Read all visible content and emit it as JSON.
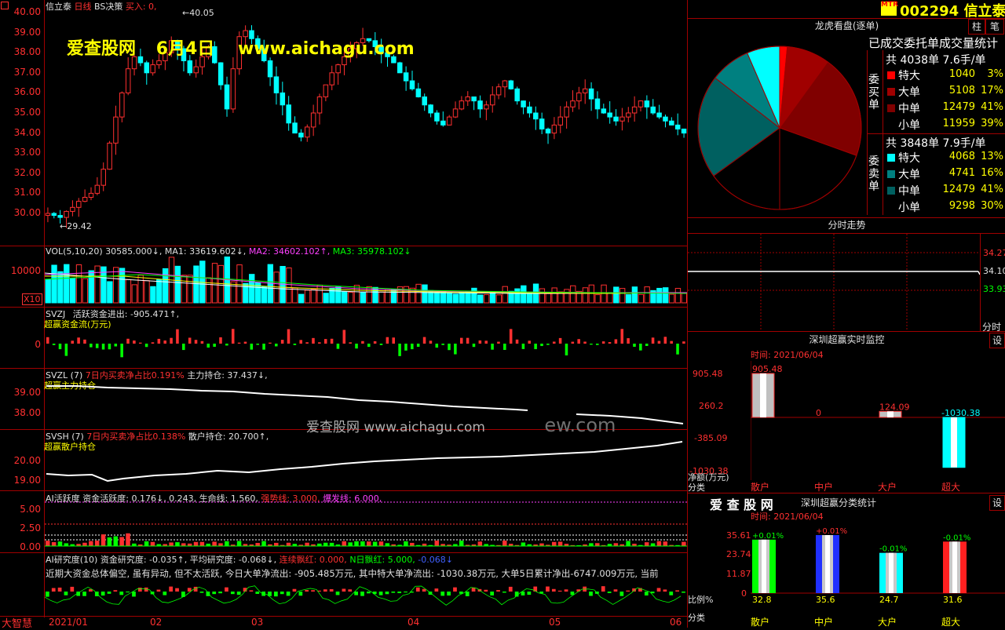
{
  "main": {
    "stock_name": "信立泰",
    "period": "日线",
    "indicator": "BS决策",
    "buy_label": "买入: 0,",
    "high_mark": "40.05",
    "low_mark": "29.42",
    "y_ticks": [
      "40.00",
      "39.00",
      "38.00",
      "37.00",
      "36.00",
      "35.00",
      "34.00",
      "33.00",
      "32.00",
      "31.00",
      "30.00"
    ],
    "watermark_site": "爱查股网",
    "watermark_date": "6月4日",
    "watermark_url": "www.aichagu.com",
    "center_watermark": "爱查股网   www.aichagu.com",
    "center_watermark_tail": "ew.com"
  },
  "vol": {
    "header": "VOL(5,10,20) 30585.000↓, MA1: 33619.602↓, MA2: 34602.102↑, MA3: 35978.102↓",
    "label": "VOL(5,10,20)",
    "value": "30585.000↓,",
    "ma1": "MA1: 33619.602↓,",
    "ma2": "MA2: 34602.102↑,",
    "ma3": "MA3: 35978.102↓",
    "tick": "10000",
    "unit": "X10"
  },
  "svzj": {
    "label": "SVZJ",
    "text": "活跃资金进出: -905.471↑,",
    "sub": "超赢资金流(万元)",
    "tick": "0"
  },
  "svzl": {
    "label": "SVZL (7)",
    "ratio": "7日内买卖净占比0.191%",
    "hold": "主力持仓: 37.437↓,",
    "sub": "超赢主力持仓",
    "ticks": [
      "39.00",
      "38.00"
    ]
  },
  "svsh": {
    "label": "SVSH (7)",
    "ratio": "7日内买卖净占比0.138%",
    "hold": "散户持仓: 20.700↑,",
    "sub": "超赢散户持仓",
    "ticks": [
      "20.00",
      "19.00"
    ]
  },
  "ai_active": {
    "label": "AI活跃度",
    "text": "资金活跃度: 0.176↓, 0.243, 生命线: 1.560,",
    "strong": "强势线: 3.000,",
    "burst": "爆发线: 6.000,",
    "ticks": [
      "5.00",
      "2.50",
      "0.00"
    ]
  },
  "ai_research": {
    "label": "AI研究度(10)",
    "text": "资金研究度: -0.035↑, 平均研究度: -0.068↓,",
    "red_text": "连续飘红: 0.000,",
    "n_text": "N日飘红: 5.000,",
    "tail": "-0.068↓",
    "comment": "近期大资金总体偏空, 虽有异动, 但不太活跃, 今日大单净流出: -905.485万元, 其中特大单净流出: -1030.38万元, 大单5日累计净出-6747.009万元, 当前"
  },
  "bottom": {
    "brand": "大智慧",
    "dates": [
      "2021/01",
      "02",
      "03",
      "04",
      "05",
      "06"
    ]
  },
  "right": {
    "stock_code": "002294",
    "stock_name": "信立泰",
    "mtr": "MTR",
    "btn_zhu": "柱",
    "btn_bi": "笔",
    "lh_title": "龙虎看盘(逐单)",
    "lh_sub": "已成交委托单成交量统计",
    "buy_side": "委买单",
    "sell_side": "委卖单",
    "buy_total": "共 4038单 7.6手/单",
    "sell_total": "共 3848单 7.9手/单",
    "buy_rows": [
      {
        "name": "特大",
        "val": "1040",
        "pct": "3%",
        "color": "#ff0000"
      },
      {
        "name": "大单",
        "val": "5108",
        "pct": "17%",
        "color": "#a00000"
      },
      {
        "name": "中单",
        "val": "12479",
        "pct": "41%",
        "color": "#800000"
      },
      {
        "name": "小单",
        "val": "11959",
        "pct": "39%",
        "color": "#000000"
      }
    ],
    "sell_rows": [
      {
        "name": "特大",
        "val": "4068",
        "pct": "13%",
        "color": "#00ffff"
      },
      {
        "name": "大单",
        "val": "4741",
        "pct": "16%",
        "color": "#008080"
      },
      {
        "name": "中单",
        "val": "12479",
        "pct": "41%",
        "color": "#006060"
      },
      {
        "name": "小单",
        "val": "9298",
        "pct": "30%",
        "color": "#000000"
      }
    ],
    "fs_title": "分时走势",
    "fs_ticks": [
      "34.27",
      "34.10",
      "33.93"
    ],
    "fs_time": "分时",
    "mon_title": "深圳超赢实时监控",
    "mon_set": "设",
    "mon_time": "时间: 2021/06/04",
    "mon_ticks": [
      "905.48",
      "260.2",
      "-385.09",
      "-1030.38"
    ],
    "mon_values": [
      "905.48",
      "0",
      "124.09",
      "-1030.38"
    ],
    "mon_ylabel": "净额(万元)",
    "mon_xlabel": "分类",
    "categories": [
      "散户",
      "中户",
      "大户",
      "超大"
    ],
    "cls_brand": "爱 查 股 网",
    "cls_title": "深圳超赢分类统计",
    "cls_set": "设",
    "cls_time": "时间: 2021/06/04",
    "cls_ticks": [
      "35.61",
      "23.74",
      "11.87",
      "0"
    ],
    "cls_change": [
      "+0.01%",
      "+0.01%",
      "-0.01%",
      "-0.01%"
    ],
    "cls_values": [
      "32.8",
      "35.6",
      "24.7",
      "31.6"
    ],
    "cls_ylabel": "比例%",
    "cls_xlabel": "分类"
  }
}
